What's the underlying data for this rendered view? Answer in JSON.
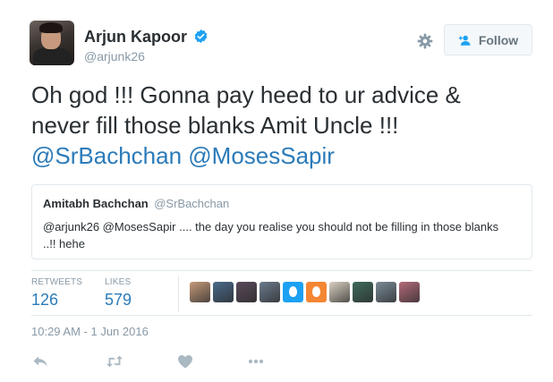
{
  "user": {
    "display_name": "Arjun Kapoor",
    "handle": "@arjunk26",
    "verified": true
  },
  "header": {
    "follow_label": "Follow"
  },
  "tweet": {
    "line1": "Oh god !!! Gonna pay heed to ur advice &",
    "line2": "never fill those blanks Amit Uncle !!!",
    "mention1": "@SrBachchan",
    "mention2": "@MosesSapir"
  },
  "quote": {
    "name": "Amitabh Bachchan",
    "handle": "@SrBachchan",
    "text": "@arjunk26 @MosesSapir .... the day you realise you should not be filling in those blanks ..!! hehe"
  },
  "stats": {
    "retweets_label": "RETWEETS",
    "retweets_value": "126",
    "likes_label": "LIKES",
    "likes_value": "579"
  },
  "likers": [
    {
      "name": "liker-avatar-1",
      "color": "#c49a7a"
    },
    {
      "name": "liker-avatar-2",
      "color": "#4a6a8a"
    },
    {
      "name": "liker-avatar-3",
      "color": "#5a4a5a"
    },
    {
      "name": "liker-avatar-4",
      "color": "#6b7a8c"
    },
    {
      "name": "liker-avatar-egg-blue",
      "color": "#1da1f2"
    },
    {
      "name": "liker-avatar-egg-orange",
      "color": "#f58634"
    },
    {
      "name": "liker-avatar-7",
      "color": "#d8cfc0"
    },
    {
      "name": "liker-avatar-8",
      "color": "#3f6a5a"
    },
    {
      "name": "liker-avatar-9",
      "color": "#7a8a96"
    },
    {
      "name": "liker-avatar-10",
      "color": "#b46a7a"
    }
  ],
  "timestamp": "10:29 AM - 1 Jun 2016",
  "colors": {
    "link": "#2b7bb9",
    "muted": "#8899a6",
    "verified": "#1da1f2",
    "border": "#e1e8ed"
  },
  "icons": {
    "verified": "verified-badge-icon",
    "settings": "gear-icon",
    "follow": "follow-person-plus-icon",
    "reply": "reply-icon",
    "retweet": "retweet-icon",
    "like": "heart-icon",
    "more": "more-dots-icon"
  }
}
